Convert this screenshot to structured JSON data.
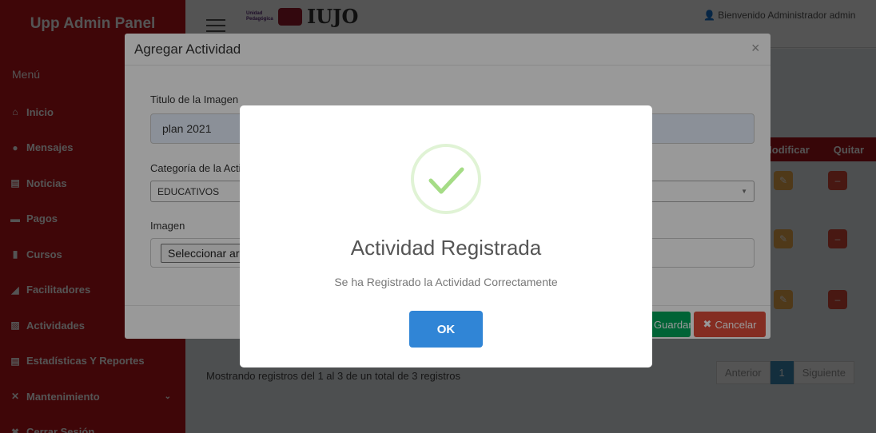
{
  "app": {
    "brand": "Upp Admin Panel",
    "logo_small": "Unidad Pedagógica",
    "logo_text": "IUJO",
    "welcome": "Bienvenido Administrador admin"
  },
  "sidebar": {
    "menu_title": "Menú",
    "items": [
      {
        "label": "Inicio",
        "icon": "home-icon",
        "glyph": "⌂"
      },
      {
        "label": "Mensajes",
        "icon": "comment-icon",
        "glyph": "●"
      },
      {
        "label": "Noticias",
        "icon": "newspaper-icon",
        "glyph": "▤"
      },
      {
        "label": "Pagos",
        "icon": "credit-card-icon",
        "glyph": "▬"
      },
      {
        "label": "Cursos",
        "icon": "book-icon",
        "glyph": "▮"
      },
      {
        "label": "Facilitadores",
        "icon": "bullhorn-icon",
        "glyph": "◢"
      },
      {
        "label": "Actividades",
        "icon": "image-icon",
        "glyph": "▨"
      },
      {
        "label": "Estadísticas Y Reportes",
        "icon": "file-icon",
        "glyph": "▤"
      },
      {
        "label": "Mantenimiento",
        "icon": "wrench-icon",
        "glyph": "✕"
      },
      {
        "label": "Cerrar Sesión",
        "icon": "close-box-icon",
        "glyph": "✖"
      }
    ]
  },
  "table": {
    "col_edit": "Modificar",
    "col_delete": "Quitar",
    "edit_glyph": "✎",
    "delete_glyph": "–"
  },
  "footer": {
    "showing": "Mostrando registros del 1 al 3 de un total de 3 registros",
    "prev": "Anterior",
    "page": "1",
    "next": "Siguiente"
  },
  "modal": {
    "title": "Agregar Actividad",
    "close": "×",
    "title_label": "Titulo de la Imagen",
    "title_value": "plan 2021",
    "category_label": "Categoría de la Actividad",
    "category_value": "EDUCATIVOS",
    "image_label": "Imagen",
    "file_button": "Seleccionar archivo",
    "save": "Guardar",
    "cancel": "Cancelar"
  },
  "alert": {
    "title": "Actividad Registrada",
    "message": "Se ha Registrado la Actividad Correctamente",
    "ok": "OK"
  },
  "colors": {
    "sidebar": "#c2141a",
    "success": "#a5dc86",
    "ok_button": "#3085d6"
  }
}
